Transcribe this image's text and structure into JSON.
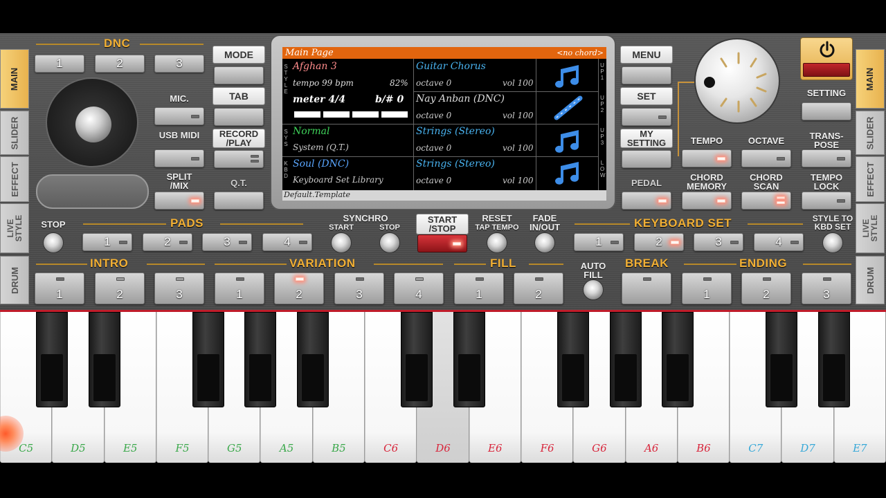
{
  "side_tabs_left": [
    "MAIN",
    "SLIDER",
    "EFFECT",
    "LIVE STYLE",
    "DRUM"
  ],
  "side_tabs_right": [
    "MAIN",
    "SLIDER",
    "EFFECT",
    "LIVE STYLE",
    "DRUM"
  ],
  "dnc": {
    "title": "DNC",
    "buttons": [
      "1",
      "2",
      "3"
    ]
  },
  "left_labels": {
    "mic": "MIC.",
    "usb_midi": "USB MIDI",
    "split_mix": "SPLIT /MIX"
  },
  "center_left": {
    "mode": "MODE",
    "tab": "TAB",
    "record_play": "RECORD /PLAY",
    "qt": "Q.T."
  },
  "display": {
    "header": "Main Page",
    "chord": "<no chord>",
    "style_name": "Afghan 3",
    "tempo": "tempo 99 bpm",
    "percent": "82%",
    "meter": "meter 4/4",
    "bsharp": "b/# 0",
    "sys_name": "Normal",
    "sys_sub": "System (Q.T.)",
    "kbd_name": "Soul (DNC)",
    "kbd_sub": "Keyboard Set Library",
    "footer": "Default.Template",
    "side_style": "STYLE",
    "side_sys": "SYS",
    "side_kbd": "KBD",
    "voices": [
      {
        "name": "Guitar Chorus",
        "octave": "octave 0",
        "vol": "vol 100",
        "tag": "UP1"
      },
      {
        "name": "Nay Anban (DNC)",
        "octave": "octave 0",
        "vol": "vol 100",
        "tag": "UP2"
      },
      {
        "name": "Strings (Stereo)",
        "octave": "octave 0",
        "vol": "vol 100",
        "tag": "UP3"
      },
      {
        "name": "Strings (Stereo)",
        "octave": "octave 0",
        "vol": "vol 100",
        "tag": "LOW"
      }
    ]
  },
  "center_right": {
    "menu": "MENU",
    "set": "SET",
    "my_setting": "MY SETTING",
    "pedal": "PEDAL"
  },
  "right_labels": {
    "setting": "SETTING",
    "tempo": "TEMPO",
    "octave": "OCTAVE",
    "transpose": "TRANS- POSE",
    "chord_memory": "CHORD MEMORY",
    "chord_scan": "CHORD SCAN",
    "tempo_lock": "TEMPO LOCK"
  },
  "pads": {
    "stop": "STOP",
    "title": "PADS",
    "buttons": [
      "1",
      "2",
      "3",
      "4"
    ]
  },
  "synchro": {
    "title": "SYNCHRO",
    "start": "START",
    "stop": "STOP"
  },
  "start_stop": "START /STOP",
  "reset": "RESET",
  "tap_tempo": "TAP TEMPO",
  "fade": "FADE IN/OUT",
  "keyboard_set": {
    "title": "KEYBOARD SET",
    "buttons": [
      "1",
      "2",
      "3",
      "4"
    ],
    "style_to_kbd": "STYLE TO KBD SET"
  },
  "intro": {
    "title": "INTRO",
    "buttons": [
      "1",
      "2",
      "3"
    ]
  },
  "variation": {
    "title": "VARIATION",
    "buttons": [
      "1",
      "2",
      "3",
      "4"
    ]
  },
  "fill": {
    "title": "FILL",
    "buttons": [
      "1",
      "2"
    ]
  },
  "auto_fill": "AUTO FILL",
  "break": {
    "title": "BREAK"
  },
  "ending": {
    "title": "ENDING",
    "buttons": [
      "1",
      "2",
      "3"
    ]
  },
  "keys": [
    {
      "note": "C5",
      "color": "#3aa84a"
    },
    {
      "note": "D5",
      "color": "#3aa84a"
    },
    {
      "note": "E5",
      "color": "#3aa84a"
    },
    {
      "note": "F5",
      "color": "#3aa84a"
    },
    {
      "note": "G5",
      "color": "#3aa84a"
    },
    {
      "note": "A5",
      "color": "#3aa84a"
    },
    {
      "note": "B5",
      "color": "#3aa84a"
    },
    {
      "note": "C6",
      "color": "#d8243a"
    },
    {
      "note": "D6",
      "color": "#d8243a"
    },
    {
      "note": "E6",
      "color": "#d8243a"
    },
    {
      "note": "F6",
      "color": "#d8243a"
    },
    {
      "note": "G6",
      "color": "#d8243a"
    },
    {
      "note": "A6",
      "color": "#d8243a"
    },
    {
      "note": "B6",
      "color": "#d8243a"
    },
    {
      "note": "C7",
      "color": "#36a8d8"
    },
    {
      "note": "D7",
      "color": "#36a8d8"
    },
    {
      "note": "E7",
      "color": "#36a8d8"
    }
  ],
  "pressed_key": "D6",
  "colors": {
    "accent": "#f2b035",
    "header_bar": "#e2650e",
    "voice_text": "#49b3f0",
    "sys_green": "#3fd35a",
    "kbd_blue": "#5aa6ff",
    "style_red": "#ff8c8c"
  }
}
